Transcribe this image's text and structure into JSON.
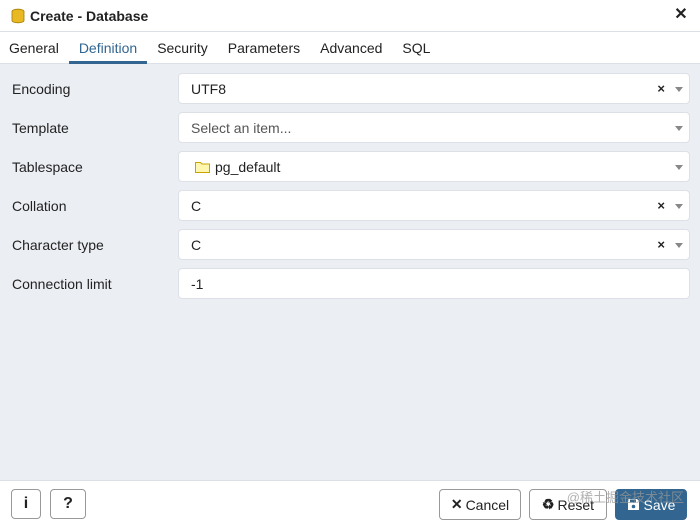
{
  "window": {
    "title": "Create - Database"
  },
  "tabs": [
    {
      "label": "General"
    },
    {
      "label": "Definition",
      "active": true
    },
    {
      "label": "Security"
    },
    {
      "label": "Parameters"
    },
    {
      "label": "Advanced"
    },
    {
      "label": "SQL"
    }
  ],
  "form": {
    "encoding": {
      "label": "Encoding",
      "value": "UTF8"
    },
    "template": {
      "label": "Template",
      "placeholder": "Select an item..."
    },
    "tablespace": {
      "label": "Tablespace",
      "value": "pg_default"
    },
    "collation": {
      "label": "Collation",
      "value": "C"
    },
    "character_type": {
      "label": "Character type",
      "value": "C"
    },
    "connection_limit": {
      "label": "Connection limit",
      "value": "-1"
    }
  },
  "footer": {
    "info_label": "i",
    "help_label": "?",
    "cancel_label": "Cancel",
    "reset_label": "Reset",
    "save_label": "Save",
    "watermark": "@稀土掘金技术社区"
  },
  "colors": {
    "accent": "#326690",
    "panel_bg": "#ebeef3",
    "border": "#dde0e6"
  },
  "icons": {
    "title": "database-icon",
    "tablespace": "folder-icon"
  }
}
